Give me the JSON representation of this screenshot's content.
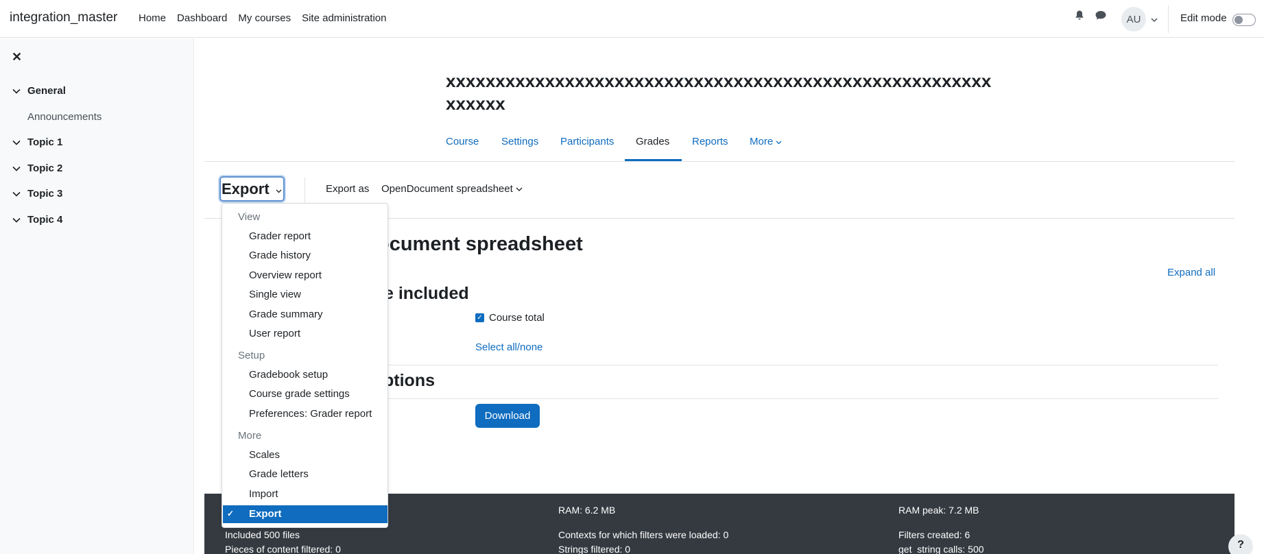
{
  "navbar": {
    "brand": "integration_master",
    "links": [
      "Home",
      "Dashboard",
      "My courses",
      "Site administration"
    ],
    "avatar_initials": "AU",
    "edit_mode_label": "Edit mode",
    "edit_mode_on": false
  },
  "drawer": {
    "sections": [
      "General",
      "Topic 1",
      "Topic 2",
      "Topic 3",
      "Topic 4"
    ],
    "general_items": [
      "Announcements"
    ]
  },
  "course": {
    "title": "xxxxxxxxxxxxxxxxxxxxxxxxxxxxxxxxxxxxxxxxxxxxxxxxxxxxxxxxxxxxx"
  },
  "secondary_nav": {
    "tabs": [
      "Course",
      "Settings",
      "Participants",
      "Grades",
      "Reports",
      "More"
    ],
    "active_tab": "Grades"
  },
  "tertiary": {
    "selector_label": "Export",
    "export_as_label": "Export as",
    "export_as_value": "OpenDocument spreadsheet"
  },
  "page": {
    "heading": "ocument spreadsheet",
    "section1_heading": "e included",
    "section2_heading": "ptions",
    "expand_all": "Expand all",
    "course_total_label": "Course total",
    "course_total_checked": true,
    "select_all": "Select all/none",
    "download": "Download"
  },
  "dropdown": {
    "view_header": "View",
    "view_items": [
      "Grader report",
      "Grade history",
      "Overview report",
      "Single view",
      "Grade summary",
      "User report"
    ],
    "setup_header": "Setup",
    "setup_items": [
      "Gradebook setup",
      "Course grade settings",
      "Preferences: Grader report"
    ],
    "more_header": "More",
    "more_items": [
      "Scales",
      "Grade letters",
      "Import"
    ],
    "active_item": "Export"
  },
  "footer": {
    "ram": "RAM: 6.2 MB",
    "ram_peak": "RAM peak: 7.2 MB",
    "included": "Included 500 files",
    "contexts": "Contexts for which filters were loaded: 0",
    "filters_created": "Filters created: 6",
    "pieces": "Pieces of content filtered: 0",
    "strings": "Strings filtered: 0",
    "get_string": "get_string calls: 500"
  },
  "colors": {
    "accent": "#0f6cbf",
    "footer_bg": "#343a40"
  },
  "icons": [
    "bell-icon",
    "chat-icon",
    "chevron-down-icon",
    "close-icon",
    "check-icon",
    "help-icon"
  ]
}
